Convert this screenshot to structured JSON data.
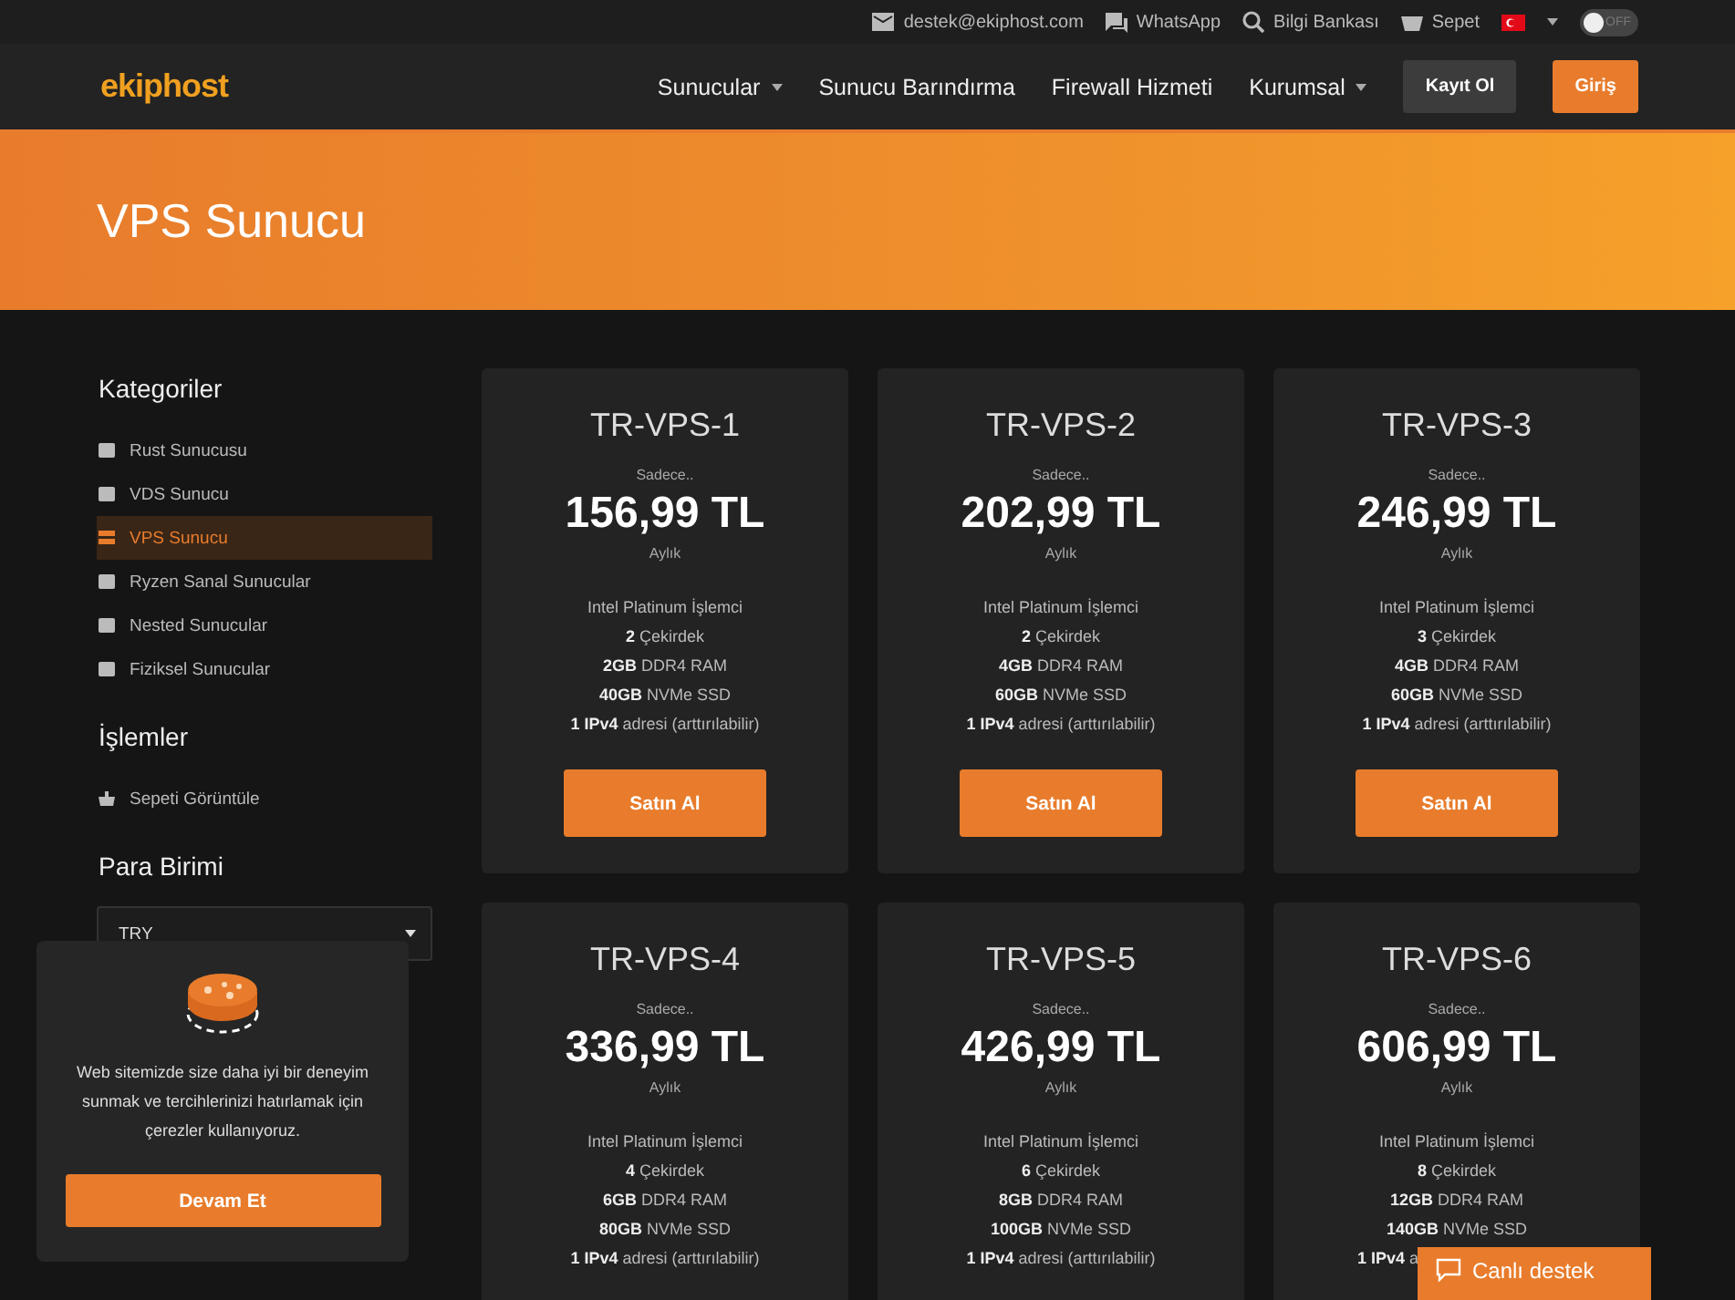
{
  "topbar": {
    "email": "destek@ekiphost.com",
    "whatsapp": "WhatsApp",
    "knowledge_base": "Bilgi Bankası",
    "cart": "Sepet",
    "dark_mode": {
      "label": "OFF",
      "on": false
    }
  },
  "nav": {
    "logo": "ekiphost",
    "items": [
      {
        "label": "Sunucular",
        "dropdown": true
      },
      {
        "label": "Sunucu Barındırma",
        "dropdown": false
      },
      {
        "label": "Firewall Hizmeti",
        "dropdown": false
      },
      {
        "label": "Kurumsal",
        "dropdown": true
      }
    ],
    "register": "Kayıt Ol",
    "login": "Giriş"
  },
  "hero": {
    "title": "VPS Sunucu"
  },
  "sidebar": {
    "categories_title": "Kategoriler",
    "categories": [
      {
        "label": "Rust Sunucusu",
        "selected": false
      },
      {
        "label": "VDS Sunucu",
        "selected": false
      },
      {
        "label": "VPS Sunucu",
        "selected": true
      },
      {
        "label": "Ryzen Sanal Sunucular",
        "selected": false
      },
      {
        "label": "Nested Sunucular",
        "selected": false
      },
      {
        "label": "Fiziksel Sunucular",
        "selected": false
      }
    ],
    "actions_title": "İşlemler",
    "actions": [
      "Sepeti Görüntüle"
    ],
    "currency_title": "Para Birimi",
    "currency": "TRY"
  },
  "products": [
    {
      "name": "TR-VPS-1",
      "prefix": "Sadece..",
      "price": "156,99 TL",
      "period": "Aylık",
      "features": [
        "Intel Platinum İşlemci",
        "**2** Çekirdek",
        "**2GB** DDR4 RAM",
        "**40GB** NVMe SSD",
        "**1 IPv4** adresi (arttırılabilir)"
      ],
      "button": "Satın Al"
    },
    {
      "name": "TR-VPS-2",
      "prefix": "Sadece..",
      "price": "202,99 TL",
      "period": "Aylık",
      "features": [
        "Intel Platinum İşlemci",
        "**2** Çekirdek",
        "**4GB** DDR4 RAM",
        "**60GB** NVMe SSD",
        "**1 IPv4** adresi (arttırılabilir)"
      ],
      "button": "Satın Al"
    },
    {
      "name": "TR-VPS-3",
      "prefix": "Sadece..",
      "price": "246,99 TL",
      "period": "Aylık",
      "features": [
        "Intel Platinum İşlemci",
        "**3** Çekirdek",
        "**4GB** DDR4 RAM",
        "**60GB** NVMe SSD",
        "**1 IPv4** adresi (arttırılabilir)"
      ],
      "button": "Satın Al"
    },
    {
      "name": "TR-VPS-4",
      "prefix": "Sadece..",
      "price": "336,99 TL",
      "period": "Aylık",
      "features": [
        "Intel Platinum İşlemci",
        "**4** Çekirdek",
        "**6GB** DDR4 RAM",
        "**80GB** NVMe SSD",
        "**1 IPv4** adresi (arttırılabilir)"
      ]
    },
    {
      "name": "TR-VPS-5",
      "prefix": "Sadece..",
      "price": "426,99 TL",
      "period": "Aylık",
      "features": [
        "Intel Platinum İşlemci",
        "**6** Çekirdek",
        "**8GB** DDR4 RAM",
        "**100GB** NVMe SSD",
        "**1 IPv4** adresi (arttırılabilir)"
      ]
    },
    {
      "name": "TR-VPS-6",
      "prefix": "Sadece..",
      "price": "606,99 TL",
      "period": "Aylık",
      "features": [
        "Intel Platinum İşlemci",
        "**8** Çekirdek",
        "**12GB** DDR4 RAM",
        "**140GB** NVMe SSD",
        "**1 IPv4** a"
      ],
      "last_feature_covered": true
    }
  ],
  "cookie_notice": {
    "text": "Web sitemizde size daha iyi bir deneyim sunmak ve tercihlerinizi hatırlamak için çerezler kullanıyoruz.",
    "button": "Devam Et"
  },
  "live_chat": {
    "label": "Canlı destek"
  }
}
